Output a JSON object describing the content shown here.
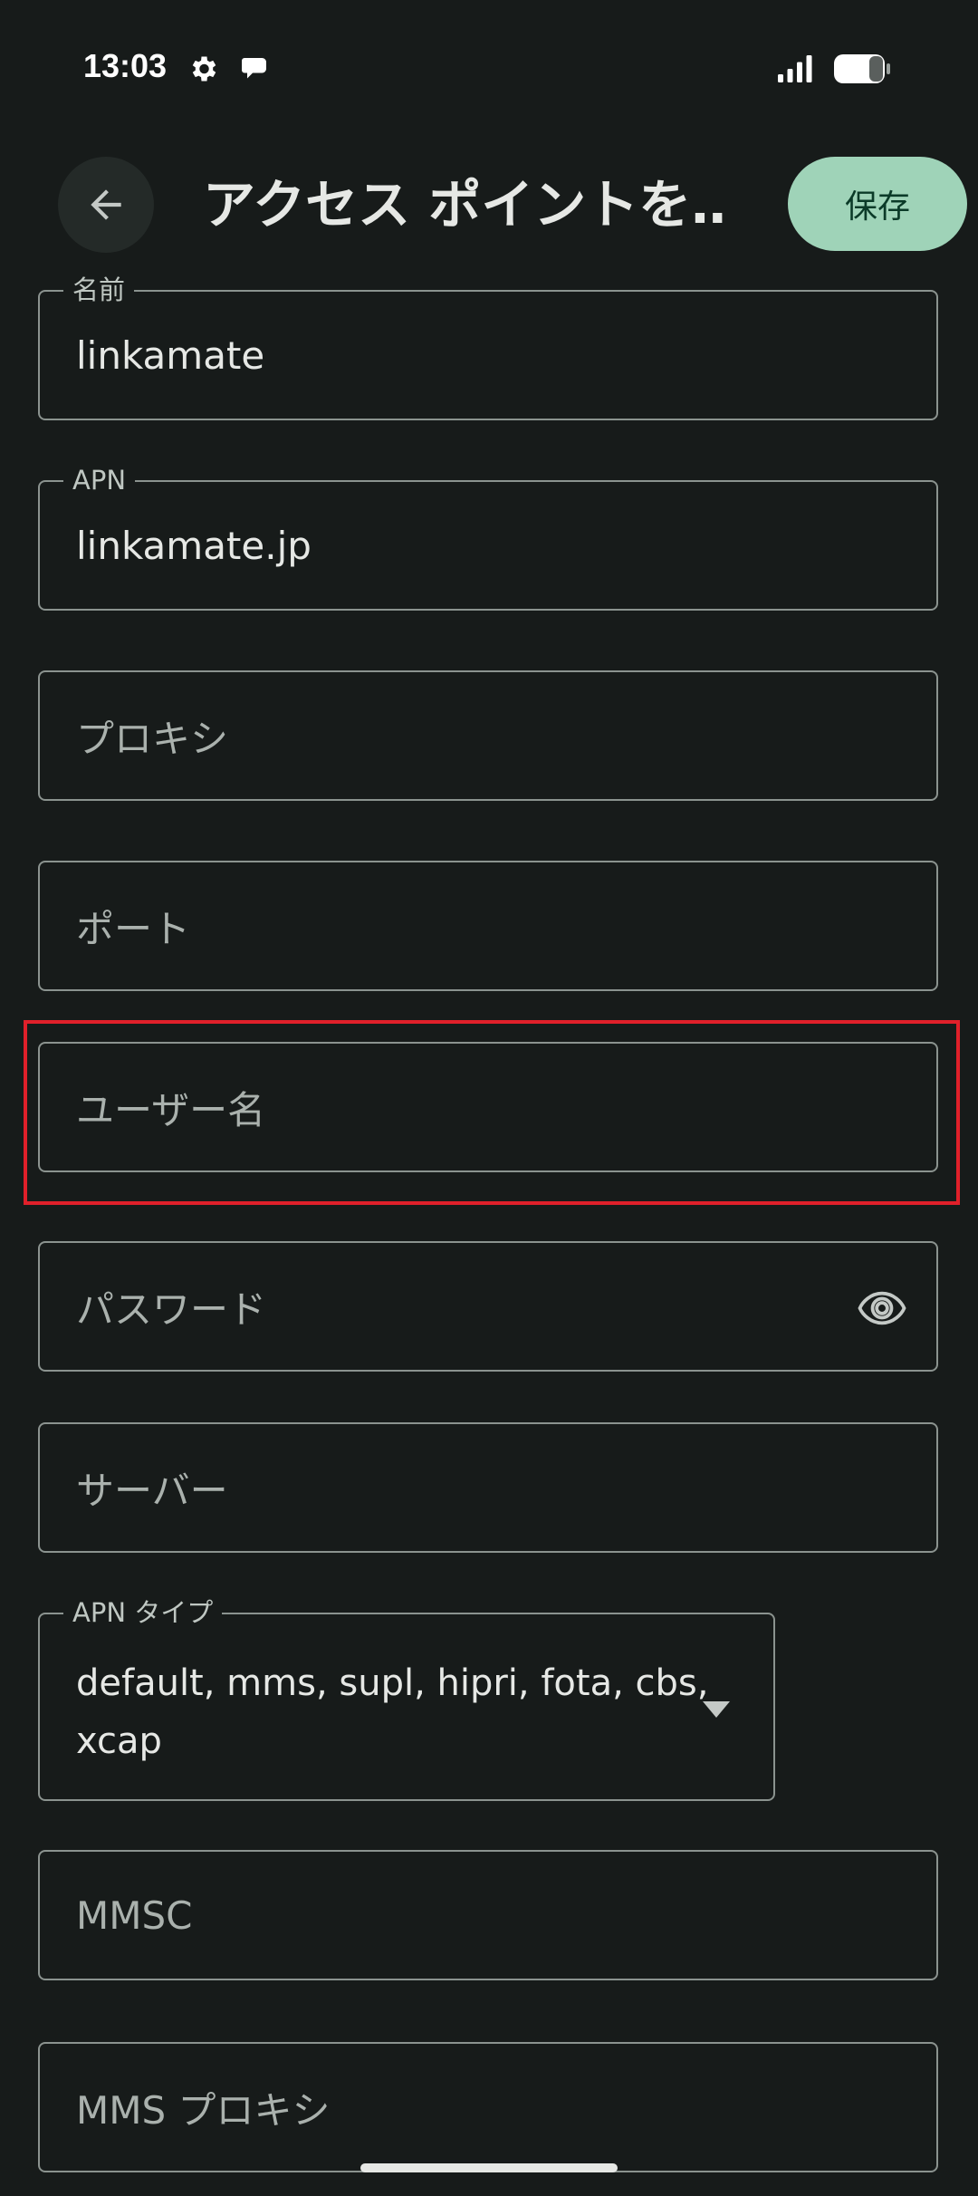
{
  "status_bar": {
    "time": "13:03",
    "icons": [
      "gear-icon",
      "chat-bubble-icon",
      "signal-icon",
      "battery-icon"
    ]
  },
  "app_bar": {
    "back_icon": "arrow-back-icon",
    "title": "アクセス ポイントを…",
    "save_label": "保存"
  },
  "fields": {
    "name": {
      "label": "名前",
      "value": "linkamate"
    },
    "apn": {
      "label": "APN",
      "value": "linkamate.jp"
    },
    "proxy": {
      "placeholder": "プロキシ"
    },
    "port": {
      "placeholder": "ポート"
    },
    "username": {
      "placeholder": "ユーザー名"
    },
    "password": {
      "placeholder": "パスワード",
      "icon": "eye-icon"
    },
    "server": {
      "placeholder": "サーバー"
    },
    "apn_type": {
      "label": "APN タイプ",
      "value": "default, mms, supl, hipri, fota, cbs, xcap",
      "icon": "dropdown-arrow-icon"
    },
    "mmsc": {
      "placeholder": "MMSC"
    },
    "mms_proxy": {
      "placeholder": "MMS プロキシ"
    }
  },
  "colors": {
    "background": "#171b1a",
    "accent": "#9fd3b8",
    "highlight": "#e0202a"
  }
}
